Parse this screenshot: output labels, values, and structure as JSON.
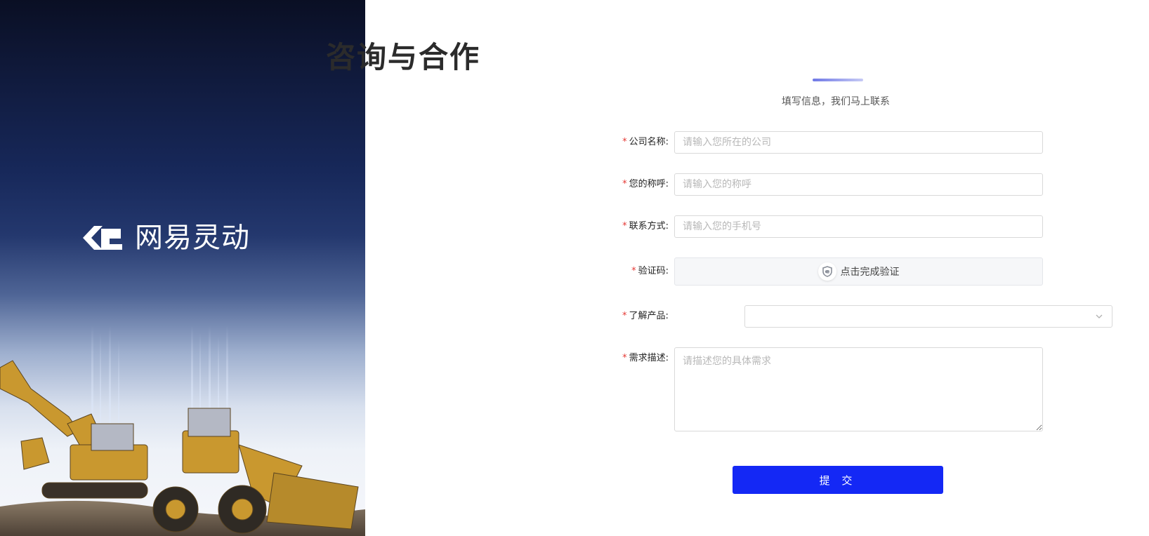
{
  "brand": {
    "logo_text": "网易灵动"
  },
  "header": {
    "title": "咨询与合作",
    "subtitle": "填写信息，我们马上联系"
  },
  "form": {
    "company": {
      "label": "公司名称:",
      "placeholder": "请输入您所在的公司",
      "value": ""
    },
    "name": {
      "label": "您的称呼:",
      "placeholder": "请输入您的称呼",
      "value": ""
    },
    "contact": {
      "label": "联系方式:",
      "placeholder": "请输入您的手机号",
      "value": ""
    },
    "captcha": {
      "label": "验证码:",
      "button_text": "点击完成验证"
    },
    "product": {
      "label": "了解产品:",
      "value": ""
    },
    "requirement": {
      "label": "需求描述:",
      "placeholder": "请描述您的具体需求",
      "value": ""
    },
    "required_mark": "*",
    "submit_label": "提 交"
  },
  "colors": {
    "primary": "#1428f5",
    "required": "#e53935",
    "underline_start": "#6f78e6",
    "underline_end": "#c6caf5"
  },
  "icons": {
    "captcha": "shield-check-icon",
    "select": "chevron-down-icon",
    "logo": "netease-lingdong-logo-icon"
  }
}
